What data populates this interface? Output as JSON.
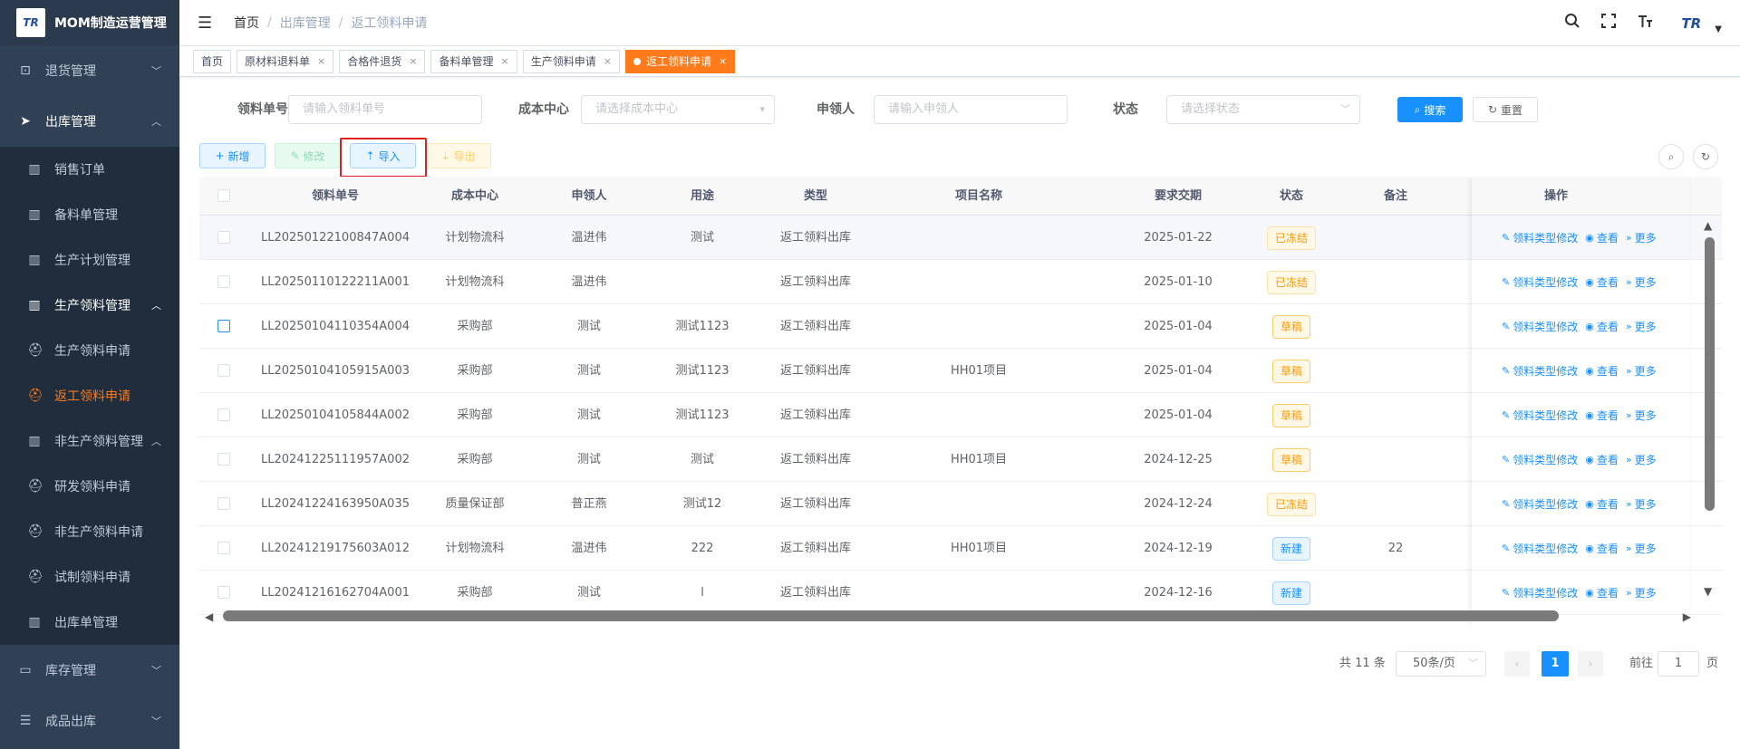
{
  "app": {
    "logo_text": "TR",
    "title": "MOM制造运营管理"
  },
  "sidebar": {
    "groups": [
      {
        "label": "退货管理",
        "icon": "return-icon",
        "glyph": "⊡",
        "expanded": false
      },
      {
        "label": "出库管理",
        "icon": "send-icon",
        "glyph": "➤",
        "expanded": true
      },
      {
        "label": "库存管理",
        "icon": "monitor-icon",
        "glyph": "▭",
        "expanded": false
      },
      {
        "label": "成品出库",
        "icon": "list-icon",
        "glyph": "☰",
        "expanded": false
      }
    ],
    "outbound_items": [
      {
        "label": "销售订单",
        "icon": "book-icon",
        "glyph": "▥"
      },
      {
        "label": "备料单管理",
        "icon": "book-icon",
        "glyph": "▥"
      },
      {
        "label": "生产计划管理",
        "icon": "book-icon",
        "glyph": "▥"
      },
      {
        "label": "生产领料管理",
        "icon": "book-icon",
        "glyph": "▥"
      }
    ],
    "production_items": [
      {
        "label": "生产领料申请",
        "icon": "helmet-icon",
        "glyph": "⛑"
      },
      {
        "label": "返工领料申请",
        "icon": "helmet-icon",
        "glyph": "⛑",
        "active": true
      }
    ],
    "nonproduction_group": {
      "label": "非生产领料管理",
      "icon": "book-icon",
      "glyph": "▥"
    },
    "nonproduction_items": [
      {
        "label": "研发领料申请",
        "icon": "helmet-icon",
        "glyph": "⛑"
      },
      {
        "label": "非生产领料申请",
        "icon": "helmet-icon",
        "glyph": "⛑"
      },
      {
        "label": "试制领料申请",
        "icon": "helmet-icon",
        "glyph": "⛑"
      }
    ],
    "outbound_order": {
      "label": "出库单管理",
      "icon": "book-icon",
      "glyph": "▥"
    }
  },
  "navbar": {
    "breadcrumb": [
      "首页",
      "出库管理",
      "返工领料申请"
    ],
    "avatar_text": "TR"
  },
  "tags": [
    {
      "label": "首页",
      "closable": false,
      "active": false
    },
    {
      "label": "原材料退料单",
      "closable": true,
      "active": false
    },
    {
      "label": "合格件退货",
      "closable": true,
      "active": false
    },
    {
      "label": "备料单管理",
      "closable": true,
      "active": false
    },
    {
      "label": "生产领料申请",
      "closable": true,
      "active": false
    },
    {
      "label": "返工领料申请",
      "closable": true,
      "active": true
    }
  ],
  "search": {
    "order_no_label": "领料单号",
    "order_no_placeholder": "请输入领料单号",
    "cost_center_label": "成本中心",
    "cost_center_placeholder": "请选择成本中心",
    "applicant_label": "申领人",
    "applicant_placeholder": "请输入申领人",
    "status_label": "状态",
    "status_placeholder": "请选择状态",
    "search_button": "搜索",
    "reset_button": "重置"
  },
  "toolbar": {
    "add": "新增",
    "edit": "修改",
    "import": "导入",
    "export": "导出"
  },
  "table": {
    "columns": [
      "领料单号",
      "成本中心",
      "申领人",
      "用途",
      "类型",
      "项目名称",
      "要求交期",
      "状态",
      "备注",
      "操作"
    ],
    "rows": [
      {
        "order_no": "LL20250122100847A004",
        "cost_center": "计划物流科",
        "applicant": "温进伟",
        "purpose": "测试",
        "type": "返工领料出库",
        "project": "",
        "due_date": "2025-01-22",
        "status": "已冻结",
        "status_kind": "frozen",
        "remark": ""
      },
      {
        "order_no": "LL20250110122211A001",
        "cost_center": "计划物流科",
        "applicant": "温进伟",
        "purpose": "",
        "type": "返工领料出库",
        "project": "",
        "due_date": "2025-01-10",
        "status": "已冻结",
        "status_kind": "frozen",
        "remark": ""
      },
      {
        "order_no": "LL20250104110354A004",
        "cost_center": "采购部",
        "applicant": "测试",
        "purpose": "测试1123",
        "type": "返工领料出库",
        "project": "",
        "due_date": "2025-01-04",
        "status": "草稿",
        "status_kind": "draft",
        "remark": ""
      },
      {
        "order_no": "LL20250104105915A003",
        "cost_center": "采购部",
        "applicant": "测试",
        "purpose": "测试1123",
        "type": "返工领料出库",
        "project": "HH01项目",
        "due_date": "2025-01-04",
        "status": "草稿",
        "status_kind": "draft",
        "remark": ""
      },
      {
        "order_no": "LL20250104105844A002",
        "cost_center": "采购部",
        "applicant": "测试",
        "purpose": "测试1123",
        "type": "返工领料出库",
        "project": "",
        "due_date": "2025-01-04",
        "status": "草稿",
        "status_kind": "draft",
        "remark": ""
      },
      {
        "order_no": "LL20241225111957A002",
        "cost_center": "采购部",
        "applicant": "测试",
        "purpose": "测试",
        "type": "返工领料出库",
        "project": "HH01项目",
        "due_date": "2024-12-25",
        "status": "草稿",
        "status_kind": "draft",
        "remark": ""
      },
      {
        "order_no": "LL20241224163950A035",
        "cost_center": "质量保证部",
        "applicant": "普正燕",
        "purpose": "测试12",
        "type": "返工领料出库",
        "project": "",
        "due_date": "2024-12-24",
        "status": "已冻结",
        "status_kind": "frozen",
        "remark": ""
      },
      {
        "order_no": "LL20241219175603A012",
        "cost_center": "计划物流科",
        "applicant": "温进伟",
        "purpose": "222",
        "type": "返工领料出库",
        "project": "HH01项目",
        "due_date": "2024-12-19",
        "status": "新建",
        "status_kind": "new",
        "remark": "22"
      },
      {
        "order_no": "LL20241216162704A001",
        "cost_center": "采购部",
        "applicant": "测试",
        "purpose": "l",
        "type": "返工领料出库",
        "project": "",
        "due_date": "2024-12-16",
        "status": "新建",
        "status_kind": "new",
        "remark": ""
      }
    ],
    "actions": {
      "modify_type": "领料类型修改",
      "view": "查看",
      "more": "更多"
    }
  },
  "pagination": {
    "total": "共 11 条",
    "page_size": "50条/页",
    "current_page": "1",
    "goto_label": "前往",
    "goto_value": "1",
    "page_unit": "页"
  },
  "colors": {
    "accent": "#1890ff",
    "active_tag": "#ff7a1a",
    "sidebar_bg": "#304156",
    "highlight": "#e02020"
  }
}
